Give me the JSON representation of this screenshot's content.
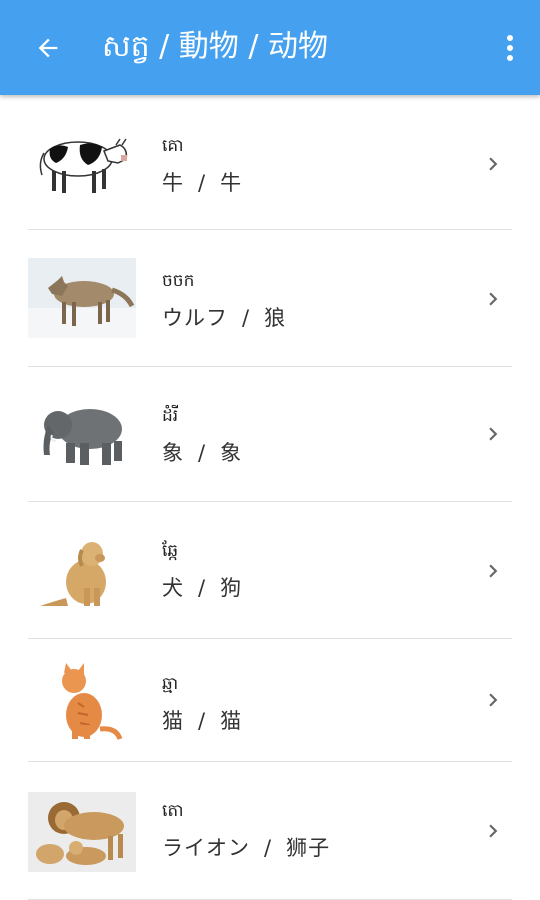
{
  "appbar": {
    "title": "សត្វ / 動物 / 动物",
    "back_icon": "arrow-left-icon",
    "menu_icon": "more-vert-icon",
    "color": "#45a0ef"
  },
  "items": [
    {
      "khmer": "គោ",
      "japanese": "牛",
      "chinese": "牛",
      "image": "cow-image"
    },
    {
      "khmer": "ចចក",
      "japanese": "ウルフ",
      "chinese": "狼",
      "image": "wolf-image"
    },
    {
      "khmer": "ដំរី",
      "japanese": "象",
      "chinese": "象",
      "image": "elephant-image"
    },
    {
      "khmer": "ឆ្កែ",
      "japanese": "犬",
      "chinese": "狗",
      "image": "dog-image"
    },
    {
      "khmer": "ឆ្មា",
      "japanese": "猫",
      "chinese": "猫",
      "image": "cat-image"
    },
    {
      "khmer": "តោ",
      "japanese": "ライオン",
      "chinese": "狮子",
      "image": "lion-image"
    }
  ],
  "separator": "/"
}
